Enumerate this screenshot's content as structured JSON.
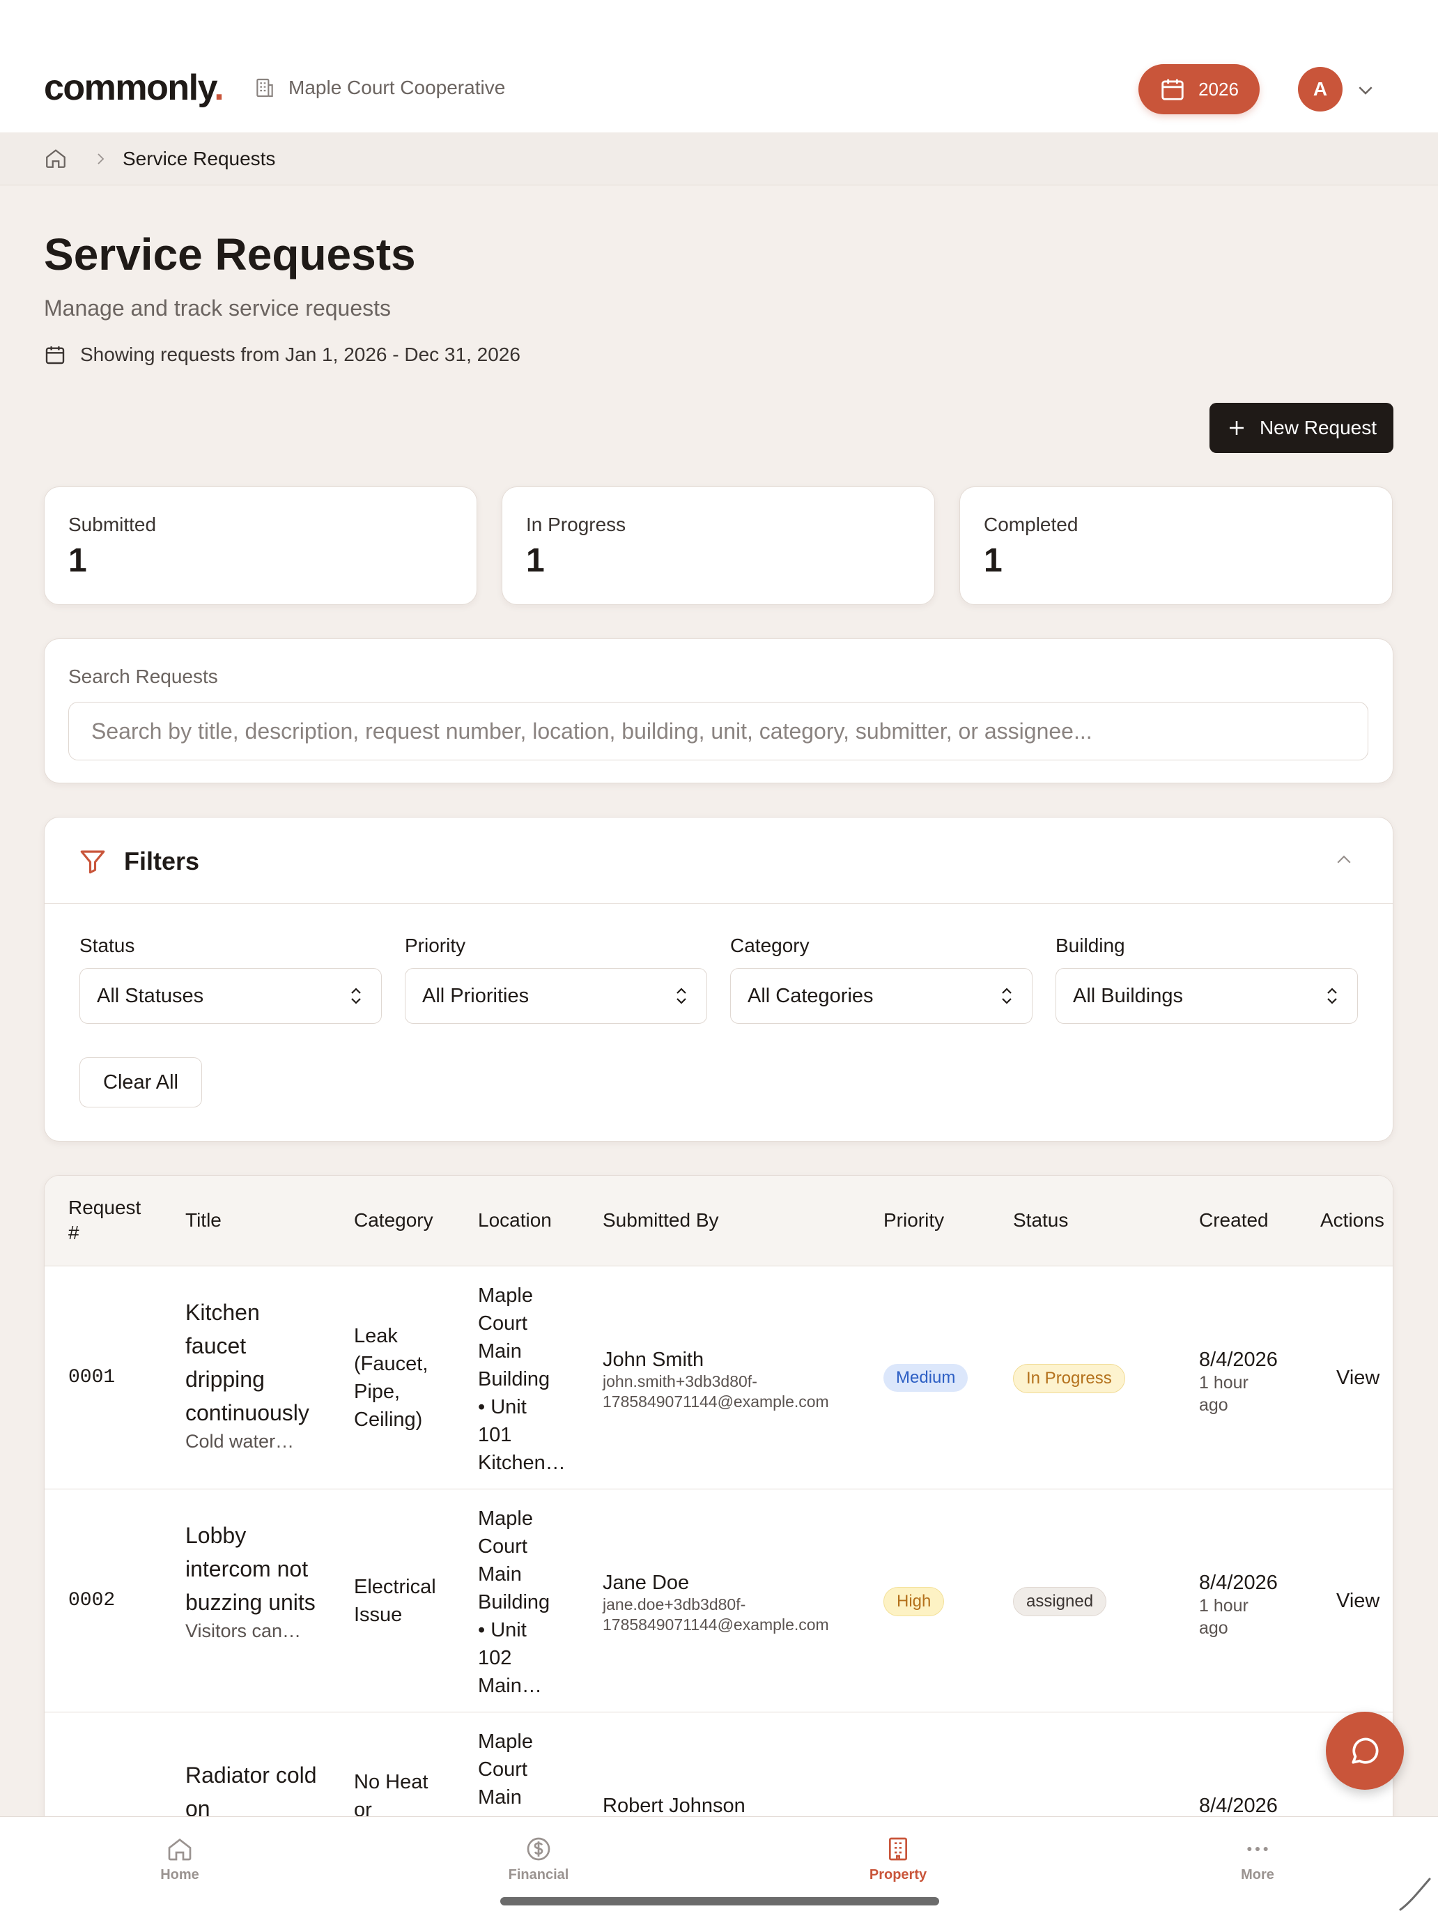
{
  "header": {
    "logo": "commonly",
    "logo_dot": ".",
    "org_name": "Maple Court Cooperative",
    "year_button": "2026",
    "avatar_initial": "A"
  },
  "breadcrumb": {
    "current": "Service Requests"
  },
  "page": {
    "title": "Service Requests",
    "subtitle": "Manage and track service requests",
    "date_range": "Showing requests from Jan 1, 2026 - Dec 31, 2026",
    "new_button": "New Request"
  },
  "stats": [
    {
      "label": "Submitted",
      "value": "1"
    },
    {
      "label": "In Progress",
      "value": "1"
    },
    {
      "label": "Completed",
      "value": "1"
    }
  ],
  "search": {
    "label": "Search Requests",
    "placeholder": "Search by title, description, request number, location, building, unit, category, submitter, or assignee...",
    "value": ""
  },
  "filters": {
    "title": "Filters",
    "status": {
      "label": "Status",
      "selected": "All Statuses"
    },
    "priority": {
      "label": "Priority",
      "selected": "All Priorities"
    },
    "category": {
      "label": "Category",
      "selected": "All Categories"
    },
    "building": {
      "label": "Building",
      "selected": "All Buildings"
    },
    "clear_button": "Clear All"
  },
  "table": {
    "columns": {
      "request_no_1": "Request",
      "request_no_2": "#",
      "title": "Title",
      "category": "Category",
      "location": "Location",
      "submitted_by": "Submitted By",
      "priority": "Priority",
      "status": "Status",
      "created": "Created",
      "actions": "Actions"
    },
    "rows": [
      {
        "number": "0001",
        "title": "Kitchen faucet dripping continuously",
        "description": "Cold water…",
        "category": "Leak (Faucet, Pipe, Ceiling)",
        "location": "Maple Court Main Building • Unit 101",
        "location_detail": "Kitchen…",
        "submitter": "John Smith",
        "email": "john.smith+3db3d80f-1785849071144@example.com",
        "priority": "Medium",
        "status": "In Progress",
        "created_date": "8/4/2026",
        "created_ago": "1 hour ago",
        "action": "View"
      },
      {
        "number": "0002",
        "title": "Lobby intercom not buzzing units",
        "description": "Visitors can…",
        "category": "Electrical Issue",
        "location": "Maple Court Main Building • Unit 102",
        "location_detail": "Main…",
        "submitter": "Jane Doe",
        "email": "jane.doe+3db3d80f-1785849071144@example.com",
        "priority": "High",
        "status": "assigned",
        "created_date": "8/4/2026",
        "created_ago": "1 hour ago",
        "action": "View"
      },
      {
        "number": "",
        "title": "Radiator cold on",
        "description": "",
        "category": "No Heat or",
        "location": "Maple Court Main",
        "location_detail": "",
        "submitter": "Robert Johnson",
        "email": "",
        "priority": "",
        "status": "",
        "created_date": "8/4/2026",
        "created_ago": "",
        "action": ""
      }
    ]
  },
  "tabbar": {
    "home": "Home",
    "financial": "Financial",
    "property": "Property",
    "more": "More"
  },
  "colors": {
    "accent": "#c9553a",
    "background": "#f4efeb",
    "text": "#1f1a17"
  },
  "icons": {
    "org": "building-icon",
    "year": "calendar-icon",
    "crumb_home": "home-icon",
    "filters": "funnel-icon",
    "chat": "chat-bubble-icon"
  }
}
